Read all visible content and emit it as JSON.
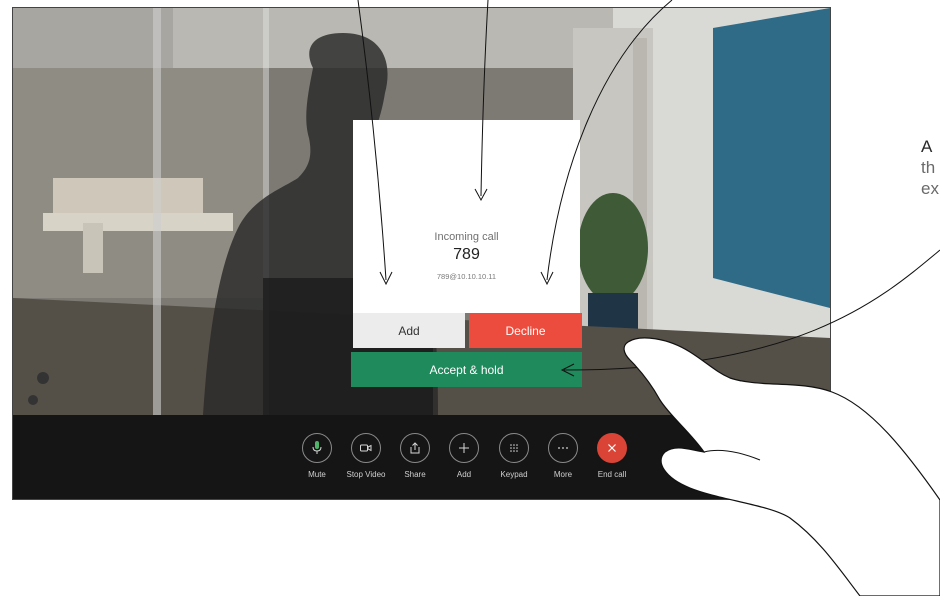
{
  "incoming_call": {
    "title": "Incoming call",
    "number": "789",
    "uri": "789@10.10.10.11"
  },
  "actions": {
    "add": "Add",
    "decline": "Decline",
    "accept_hold": "Accept & hold"
  },
  "toolbar": [
    {
      "label": "Mute",
      "icon": "microphone-icon"
    },
    {
      "label": "Stop Video",
      "icon": "video-camera-icon"
    },
    {
      "label": "Share",
      "icon": "share-icon"
    },
    {
      "label": "Add",
      "icon": "plus-icon"
    },
    {
      "label": "Keypad",
      "icon": "keypad-icon"
    },
    {
      "label": "More",
      "icon": "more-icon"
    },
    {
      "label": "End call",
      "icon": "close-icon"
    }
  ],
  "callout": {
    "line1": "A",
    "line2": "th",
    "line3": "ex"
  },
  "colors": {
    "accept": "#1f8a5c",
    "decline": "#ec4c3d",
    "end_call": "#d94437",
    "mute_active": "#4fb36a",
    "toolbar_bg": "#151515"
  }
}
